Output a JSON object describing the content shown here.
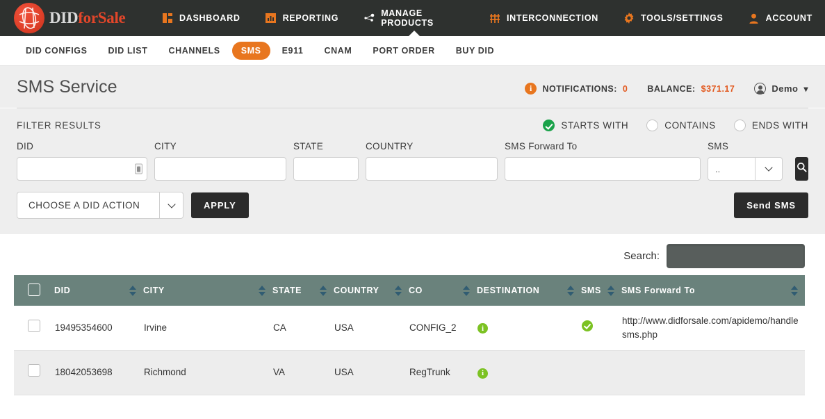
{
  "brand": {
    "did": "DID",
    "for": "for",
    "sale": "Sale",
    "logo_icon": "globe-logo-icon"
  },
  "topnav": {
    "items": [
      {
        "label": "DASHBOARD",
        "icon": "dashboard-icon",
        "active": false
      },
      {
        "label": "REPORTING",
        "icon": "bar-chart-icon",
        "active": false
      },
      {
        "label": "MANAGE PRODUCTS",
        "icon": "nodes-icon",
        "active": true
      },
      {
        "label": "INTERCONNECTION",
        "icon": "sliders-icon",
        "active": false
      },
      {
        "label": "TOOLS/SETTINGS",
        "icon": "gear-icon",
        "active": false
      },
      {
        "label": "ACCOUNT",
        "icon": "user-icon",
        "active": false
      }
    ]
  },
  "subnav": {
    "items": [
      {
        "label": "DID CONFIGS",
        "active": false
      },
      {
        "label": "DID LIST",
        "active": false
      },
      {
        "label": "CHANNELS",
        "active": false
      },
      {
        "label": "SMS",
        "active": true
      },
      {
        "label": "E911",
        "active": false
      },
      {
        "label": "CNAM",
        "active": false
      },
      {
        "label": "PORT ORDER",
        "active": false
      },
      {
        "label": "BUY DID",
        "active": false
      }
    ]
  },
  "header": {
    "title": "SMS Service",
    "notifications_label": "NOTIFICATIONS:",
    "notifications_count": "0",
    "balance_label": "BALANCE:",
    "balance_value": "$371.17",
    "user": "Demo"
  },
  "filter": {
    "title": "FILTER RESULTS",
    "match_modes": [
      {
        "label": "STARTS WITH",
        "selected": true
      },
      {
        "label": "CONTAINS",
        "selected": false
      },
      {
        "label": "ENDS WITH",
        "selected": false
      }
    ],
    "fields": [
      {
        "label": "DID",
        "value": "",
        "placeholder": ""
      },
      {
        "label": "CITY",
        "value": "",
        "placeholder": ""
      },
      {
        "label": "STATE",
        "value": "",
        "placeholder": ""
      },
      {
        "label": "COUNTRY",
        "value": "",
        "placeholder": ""
      },
      {
        "label": "SMS Forward To",
        "value": "",
        "placeholder": ""
      }
    ],
    "sms_select": {
      "label": "SMS",
      "value": ".."
    },
    "search_button_icon": "magnifier-icon"
  },
  "actions": {
    "did_action_label": "CHOOSE A DID ACTION",
    "apply_label": "APPLY",
    "send_sms_label": "Send SMS"
  },
  "search": {
    "label": "Search:",
    "value": "",
    "placeholder": ""
  },
  "table": {
    "columns": [
      {
        "label": "DID",
        "sortable": true
      },
      {
        "label": "CITY",
        "sortable": true
      },
      {
        "label": "STATE",
        "sortable": true
      },
      {
        "label": "COUNTRY",
        "sortable": true
      },
      {
        "label": "CO",
        "sortable": true
      },
      {
        "label": "DESTINATION",
        "sortable": true
      },
      {
        "label": "SMS",
        "sortable": true
      },
      {
        "label": "SMS Forward To",
        "sortable": true
      }
    ],
    "rows": [
      {
        "did": "19495354600",
        "city": "Irvine",
        "state": "CA",
        "country": "USA",
        "co": "CONFIG_2",
        "destination_icon": "info-icon",
        "sms_icon": "check-icon",
        "sms_forward_to": "http://www.didforsale.com/apidemo/handlesms.php"
      },
      {
        "did": "18042053698",
        "city": "Richmond",
        "state": "VA",
        "country": "USA",
        "co": "RegTrunk",
        "destination_icon": "info-icon",
        "sms_icon": "",
        "sms_forward_to": ""
      }
    ]
  },
  "colors": {
    "nav_bg": "#2e312f",
    "accent_orange": "#e8761f",
    "brand_red": "#e2462a",
    "table_header": "#6a827c",
    "green": "#7cc223",
    "radio_green": "#1aa24a",
    "dark_button": "#2b2b2b",
    "search_field": "#585e5c"
  }
}
